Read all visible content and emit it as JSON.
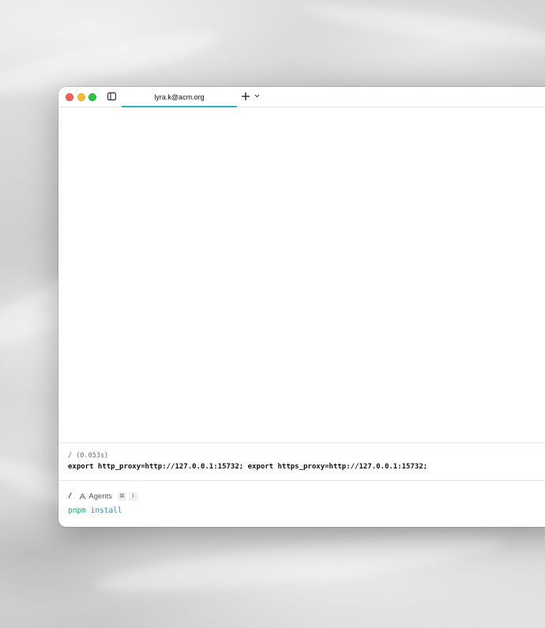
{
  "window": {
    "tab_title": "lyra.k@acm.org"
  },
  "block": {
    "meta": "/ (0.053s)",
    "command": "export http_proxy=http://127.0.0.1:15732; export https_proxy=http://127.0.0.1:15732;"
  },
  "prompt": {
    "path": "/",
    "agents_label": "Agents",
    "shortcut_keys": [
      "⌘",
      "I"
    ],
    "input_command": "pnpm",
    "input_args": " install"
  },
  "colors": {
    "tab_accent": "#2bb0c7",
    "command_token": "#1aa57a",
    "arg_token": "#2b89c8",
    "traffic_close": "#ff5f57",
    "traffic_minimize": "#febc2e",
    "traffic_maximize": "#28c840"
  },
  "icons": {
    "sidebar_toggle": "sidebar-icon",
    "new_tab": "plus-icon",
    "new_tab_menu": "chevron-down-icon",
    "agents": "agent-icon"
  }
}
